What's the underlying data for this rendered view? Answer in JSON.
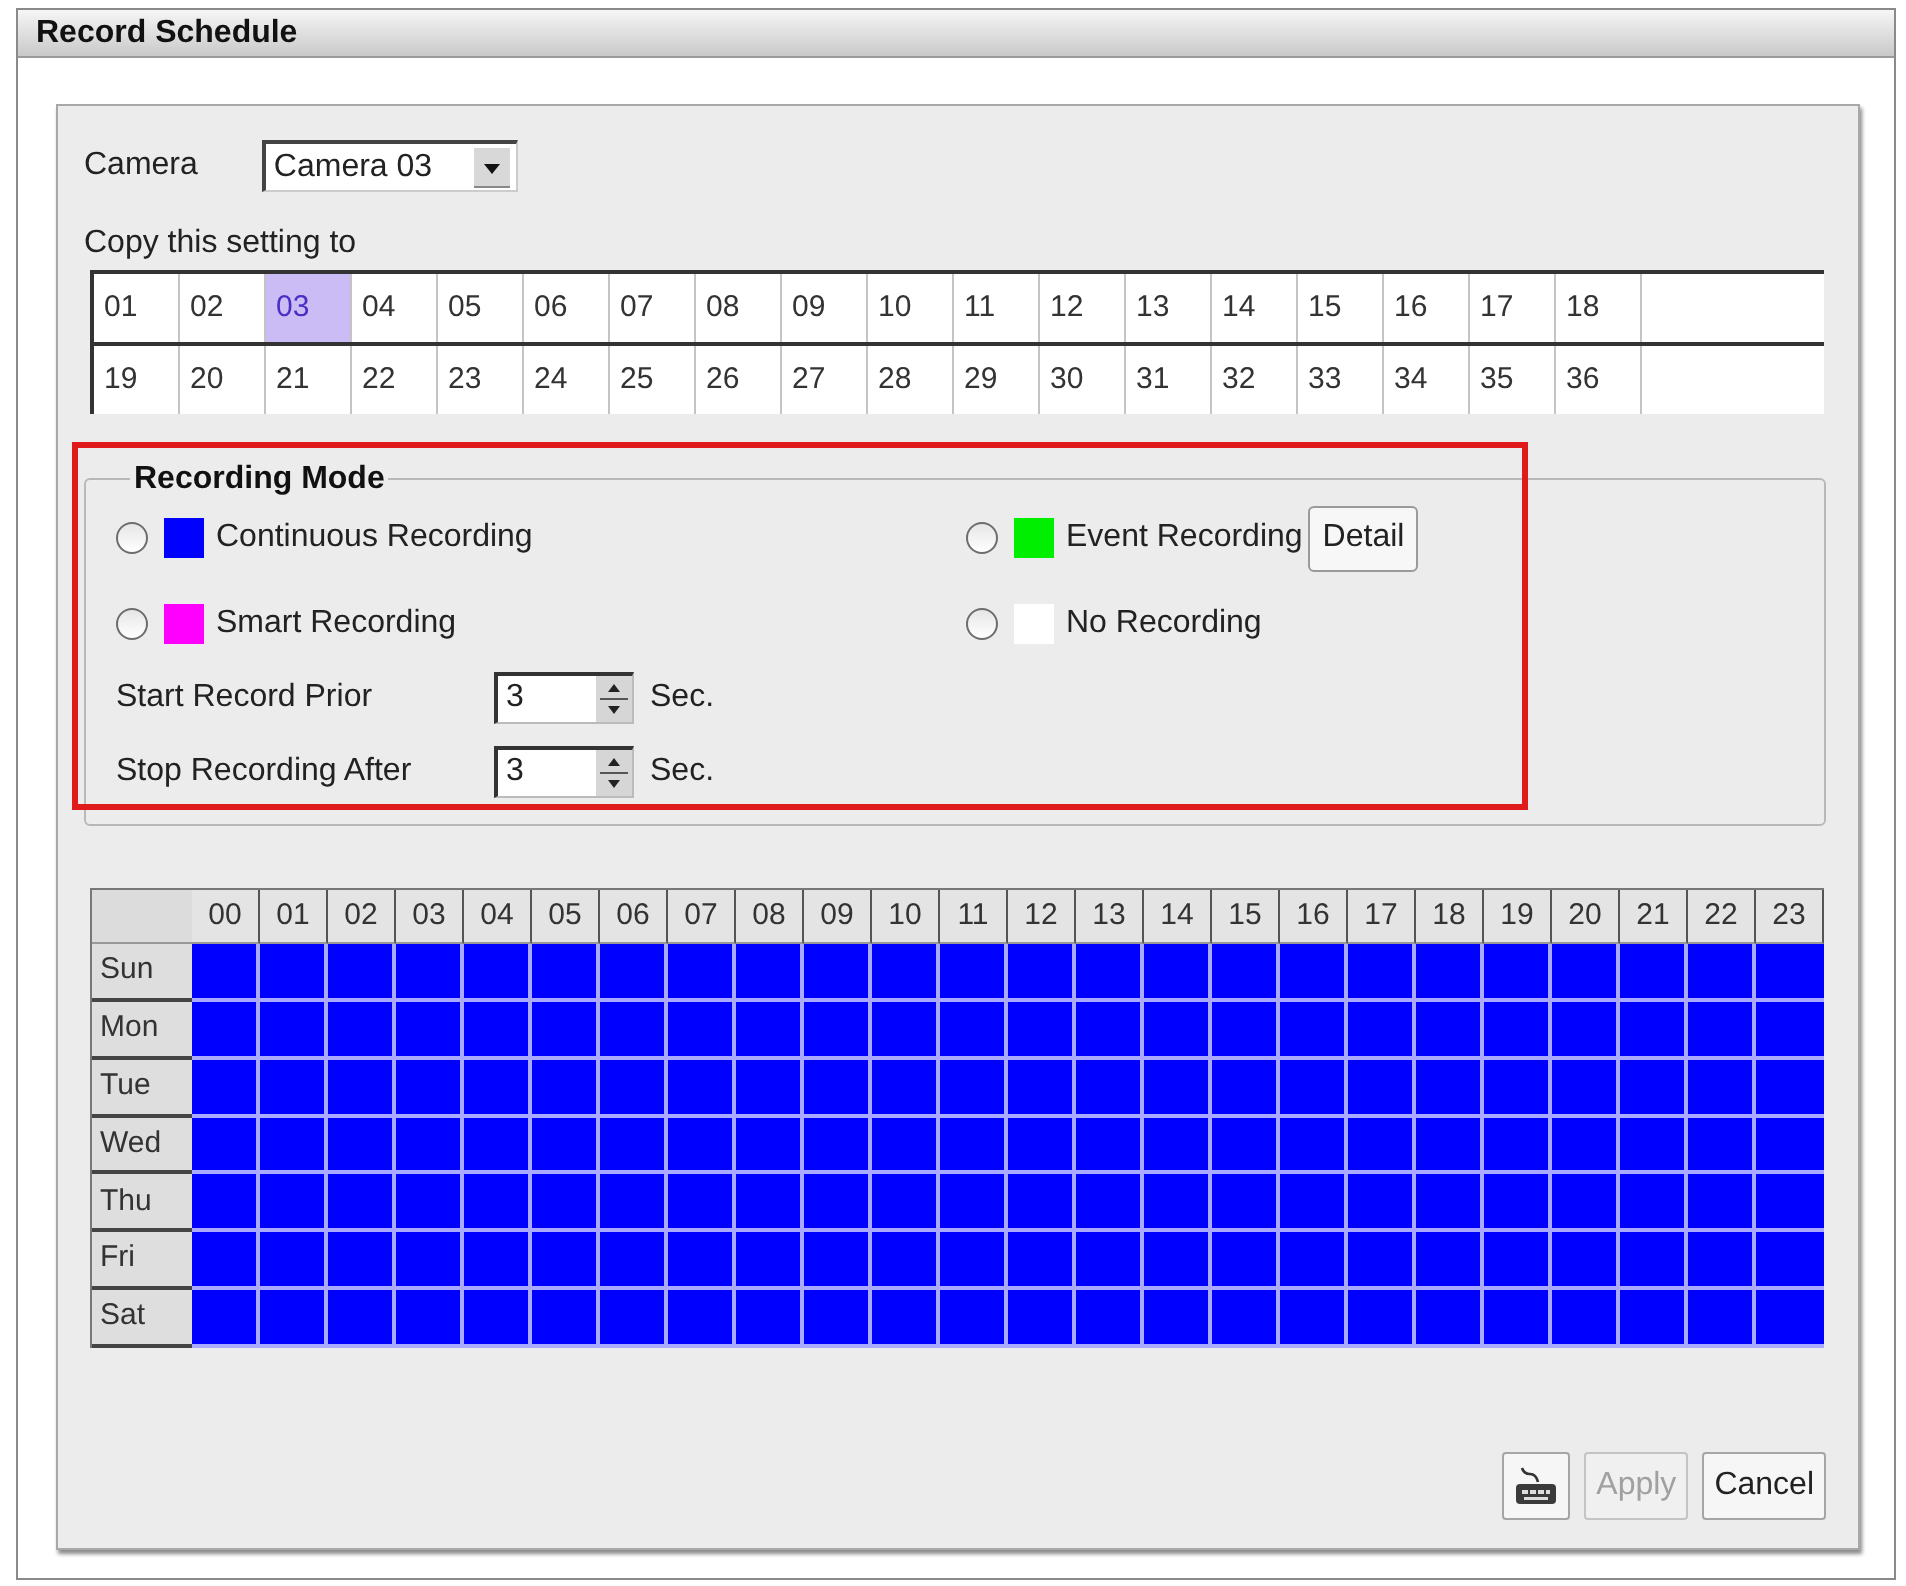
{
  "window": {
    "title": "Record Schedule"
  },
  "camera": {
    "label": "Camera",
    "value": "Camera 03"
  },
  "copy_to": {
    "label": "Copy this setting to",
    "rows": [
      {
        "cells": [
          {
            "label": "01",
            "selected": false
          },
          {
            "label": "02",
            "selected": false
          },
          {
            "label": "03",
            "selected": true
          },
          {
            "label": "04",
            "selected": false
          },
          {
            "label": "05",
            "selected": false
          },
          {
            "label": "06",
            "selected": false
          },
          {
            "label": "07",
            "selected": false
          },
          {
            "label": "08",
            "selected": false
          },
          {
            "label": "09",
            "selected": false
          },
          {
            "label": "10",
            "selected": false
          },
          {
            "label": "11",
            "selected": false
          },
          {
            "label": "12",
            "selected": false
          },
          {
            "label": "13",
            "selected": false
          },
          {
            "label": "14",
            "selected": false
          },
          {
            "label": "15",
            "selected": false
          },
          {
            "label": "16",
            "selected": false
          },
          {
            "label": "17",
            "selected": false
          },
          {
            "label": "18",
            "selected": false
          }
        ]
      },
      {
        "cells": [
          {
            "label": "19",
            "selected": false
          },
          {
            "label": "20",
            "selected": false
          },
          {
            "label": "21",
            "selected": false
          },
          {
            "label": "22",
            "selected": false
          },
          {
            "label": "23",
            "selected": false
          },
          {
            "label": "24",
            "selected": false
          },
          {
            "label": "25",
            "selected": false
          },
          {
            "label": "26",
            "selected": false
          },
          {
            "label": "27",
            "selected": false
          },
          {
            "label": "28",
            "selected": false
          },
          {
            "label": "29",
            "selected": false
          },
          {
            "label": "30",
            "selected": false
          },
          {
            "label": "31",
            "selected": false
          },
          {
            "label": "32",
            "selected": false
          },
          {
            "label": "33",
            "selected": false
          },
          {
            "label": "34",
            "selected": false
          },
          {
            "label": "35",
            "selected": false
          },
          {
            "label": "36",
            "selected": false
          }
        ]
      }
    ]
  },
  "recording_mode": {
    "title": "Recording Mode",
    "highlighted": true,
    "modes": [
      {
        "label": "Continuous Recording",
        "color": "#0000ff",
        "selected": false
      },
      {
        "label": "Event Recording",
        "color": "#00ee00",
        "selected": false,
        "button": "Detail"
      },
      {
        "label": "Smart Recording",
        "color": "#ff00ff",
        "selected": false
      },
      {
        "label": "No Recording",
        "color": "#ffffff",
        "selected": false
      }
    ],
    "timers": [
      {
        "label": "Start Record Prior",
        "value": "3",
        "unit": "Sec."
      },
      {
        "label": "Stop Recording After",
        "value": "3",
        "unit": "Sec."
      }
    ]
  },
  "schedule": {
    "hours": [
      "00",
      "01",
      "02",
      "03",
      "04",
      "05",
      "06",
      "07",
      "08",
      "09",
      "10",
      "11",
      "12",
      "13",
      "14",
      "15",
      "16",
      "17",
      "18",
      "19",
      "20",
      "21",
      "22",
      "23"
    ],
    "days": [
      {
        "label": "Sun",
        "slots": [
          {
            "color": "#0000ff"
          },
          {
            "color": "#0000ff"
          },
          {
            "color": "#0000ff"
          },
          {
            "color": "#0000ff"
          },
          {
            "color": "#0000ff"
          },
          {
            "color": "#0000ff"
          },
          {
            "color": "#0000ff"
          },
          {
            "color": "#0000ff"
          },
          {
            "color": "#0000ff"
          },
          {
            "color": "#0000ff"
          },
          {
            "color": "#0000ff"
          },
          {
            "color": "#0000ff"
          },
          {
            "color": "#0000ff"
          },
          {
            "color": "#0000ff"
          },
          {
            "color": "#0000ff"
          },
          {
            "color": "#0000ff"
          },
          {
            "color": "#0000ff"
          },
          {
            "color": "#0000ff"
          },
          {
            "color": "#0000ff"
          },
          {
            "color": "#0000ff"
          },
          {
            "color": "#0000ff"
          },
          {
            "color": "#0000ff"
          },
          {
            "color": "#0000ff"
          },
          {
            "color": "#0000ff"
          }
        ]
      },
      {
        "label": "Mon",
        "slots": [
          {
            "color": "#0000ff"
          },
          {
            "color": "#0000ff"
          },
          {
            "color": "#0000ff"
          },
          {
            "color": "#0000ff"
          },
          {
            "color": "#0000ff"
          },
          {
            "color": "#0000ff"
          },
          {
            "color": "#0000ff"
          },
          {
            "color": "#0000ff"
          },
          {
            "color": "#0000ff"
          },
          {
            "color": "#0000ff"
          },
          {
            "color": "#0000ff"
          },
          {
            "color": "#0000ff"
          },
          {
            "color": "#0000ff"
          },
          {
            "color": "#0000ff"
          },
          {
            "color": "#0000ff"
          },
          {
            "color": "#0000ff"
          },
          {
            "color": "#0000ff"
          },
          {
            "color": "#0000ff"
          },
          {
            "color": "#0000ff"
          },
          {
            "color": "#0000ff"
          },
          {
            "color": "#0000ff"
          },
          {
            "color": "#0000ff"
          },
          {
            "color": "#0000ff"
          },
          {
            "color": "#0000ff"
          }
        ]
      },
      {
        "label": "Tue",
        "slots": [
          {
            "color": "#0000ff"
          },
          {
            "color": "#0000ff"
          },
          {
            "color": "#0000ff"
          },
          {
            "color": "#0000ff"
          },
          {
            "color": "#0000ff"
          },
          {
            "color": "#0000ff"
          },
          {
            "color": "#0000ff"
          },
          {
            "color": "#0000ff"
          },
          {
            "color": "#0000ff"
          },
          {
            "color": "#0000ff"
          },
          {
            "color": "#0000ff"
          },
          {
            "color": "#0000ff"
          },
          {
            "color": "#0000ff"
          },
          {
            "color": "#0000ff"
          },
          {
            "color": "#0000ff"
          },
          {
            "color": "#0000ff"
          },
          {
            "color": "#0000ff"
          },
          {
            "color": "#0000ff"
          },
          {
            "color": "#0000ff"
          },
          {
            "color": "#0000ff"
          },
          {
            "color": "#0000ff"
          },
          {
            "color": "#0000ff"
          },
          {
            "color": "#0000ff"
          },
          {
            "color": "#0000ff"
          }
        ]
      },
      {
        "label": "Wed",
        "slots": [
          {
            "color": "#0000ff"
          },
          {
            "color": "#0000ff"
          },
          {
            "color": "#0000ff"
          },
          {
            "color": "#0000ff"
          },
          {
            "color": "#0000ff"
          },
          {
            "color": "#0000ff"
          },
          {
            "color": "#0000ff"
          },
          {
            "color": "#0000ff"
          },
          {
            "color": "#0000ff"
          },
          {
            "color": "#0000ff"
          },
          {
            "color": "#0000ff"
          },
          {
            "color": "#0000ff"
          },
          {
            "color": "#0000ff"
          },
          {
            "color": "#0000ff"
          },
          {
            "color": "#0000ff"
          },
          {
            "color": "#0000ff"
          },
          {
            "color": "#0000ff"
          },
          {
            "color": "#0000ff"
          },
          {
            "color": "#0000ff"
          },
          {
            "color": "#0000ff"
          },
          {
            "color": "#0000ff"
          },
          {
            "color": "#0000ff"
          },
          {
            "color": "#0000ff"
          },
          {
            "color": "#0000ff"
          }
        ]
      },
      {
        "label": "Thu",
        "slots": [
          {
            "color": "#0000ff"
          },
          {
            "color": "#0000ff"
          },
          {
            "color": "#0000ff"
          },
          {
            "color": "#0000ff"
          },
          {
            "color": "#0000ff"
          },
          {
            "color": "#0000ff"
          },
          {
            "color": "#0000ff"
          },
          {
            "color": "#0000ff"
          },
          {
            "color": "#0000ff"
          },
          {
            "color": "#0000ff"
          },
          {
            "color": "#0000ff"
          },
          {
            "color": "#0000ff"
          },
          {
            "color": "#0000ff"
          },
          {
            "color": "#0000ff"
          },
          {
            "color": "#0000ff"
          },
          {
            "color": "#0000ff"
          },
          {
            "color": "#0000ff"
          },
          {
            "color": "#0000ff"
          },
          {
            "color": "#0000ff"
          },
          {
            "color": "#0000ff"
          },
          {
            "color": "#0000ff"
          },
          {
            "color": "#0000ff"
          },
          {
            "color": "#0000ff"
          },
          {
            "color": "#0000ff"
          }
        ]
      },
      {
        "label": "Fri",
        "slots": [
          {
            "color": "#0000ff"
          },
          {
            "color": "#0000ff"
          },
          {
            "color": "#0000ff"
          },
          {
            "color": "#0000ff"
          },
          {
            "color": "#0000ff"
          },
          {
            "color": "#0000ff"
          },
          {
            "color": "#0000ff"
          },
          {
            "color": "#0000ff"
          },
          {
            "color": "#0000ff"
          },
          {
            "color": "#0000ff"
          },
          {
            "color": "#0000ff"
          },
          {
            "color": "#0000ff"
          },
          {
            "color": "#0000ff"
          },
          {
            "color": "#0000ff"
          },
          {
            "color": "#0000ff"
          },
          {
            "color": "#0000ff"
          },
          {
            "color": "#0000ff"
          },
          {
            "color": "#0000ff"
          },
          {
            "color": "#0000ff"
          },
          {
            "color": "#0000ff"
          },
          {
            "color": "#0000ff"
          },
          {
            "color": "#0000ff"
          },
          {
            "color": "#0000ff"
          },
          {
            "color": "#0000ff"
          }
        ]
      },
      {
        "label": "Sat",
        "slots": [
          {
            "color": "#0000ff"
          },
          {
            "color": "#0000ff"
          },
          {
            "color": "#0000ff"
          },
          {
            "color": "#0000ff"
          },
          {
            "color": "#0000ff"
          },
          {
            "color": "#0000ff"
          },
          {
            "color": "#0000ff"
          },
          {
            "color": "#0000ff"
          },
          {
            "color": "#0000ff"
          },
          {
            "color": "#0000ff"
          },
          {
            "color": "#0000ff"
          },
          {
            "color": "#0000ff"
          },
          {
            "color": "#0000ff"
          },
          {
            "color": "#0000ff"
          },
          {
            "color": "#0000ff"
          },
          {
            "color": "#0000ff"
          },
          {
            "color": "#0000ff"
          },
          {
            "color": "#0000ff"
          },
          {
            "color": "#0000ff"
          },
          {
            "color": "#0000ff"
          },
          {
            "color": "#0000ff"
          },
          {
            "color": "#0000ff"
          },
          {
            "color": "#0000ff"
          },
          {
            "color": "#0000ff"
          }
        ]
      }
    ]
  },
  "buttons": [
    {
      "kind": "icon",
      "disabled": false
    },
    {
      "kind": "text",
      "label": "Apply",
      "disabled": true
    },
    {
      "kind": "text",
      "label": "Cancel",
      "disabled": false
    }
  ]
}
